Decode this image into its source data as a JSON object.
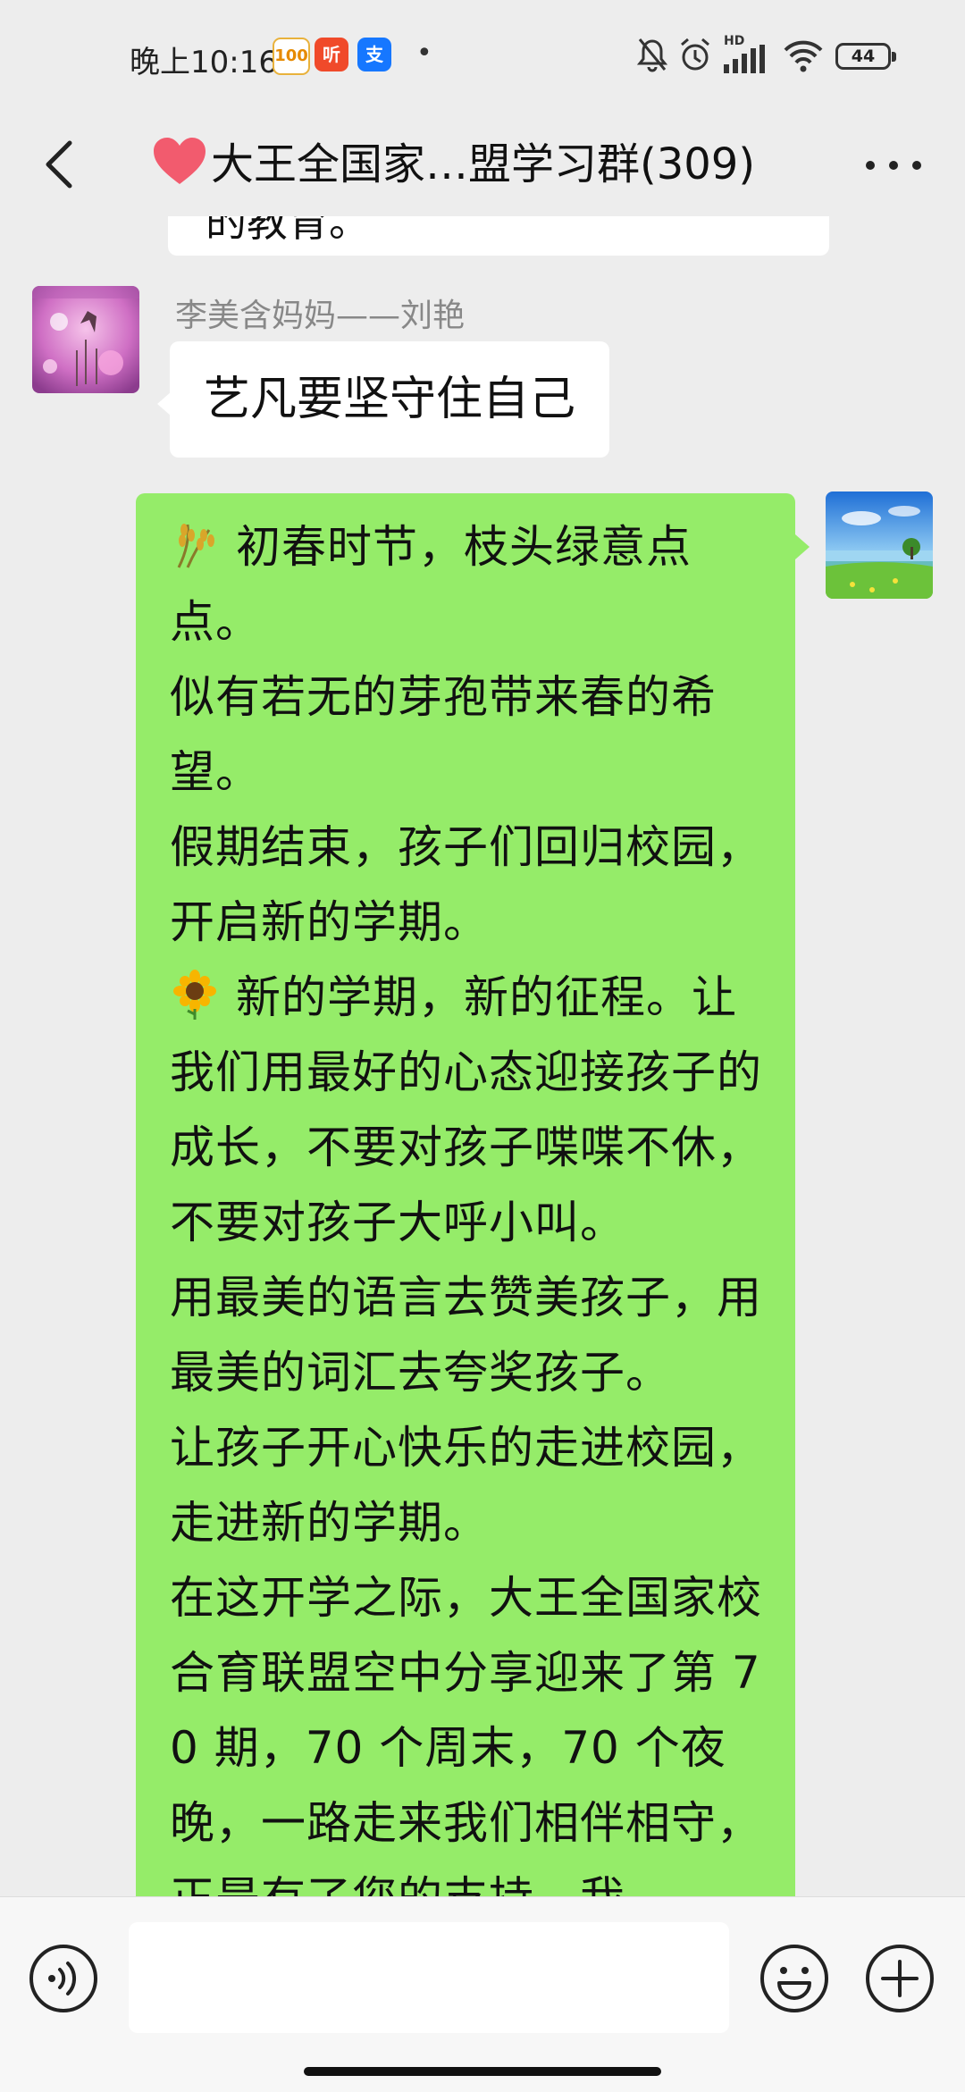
{
  "status_bar": {
    "time": "晚上10:16",
    "apps": [
      "100",
      "听",
      "支"
    ],
    "network_label": "HD",
    "battery": "44"
  },
  "header": {
    "title": "大王全国家…盟学习群(309)"
  },
  "messages": {
    "prev_text": "的教育。",
    "sender_name": "李美含妈妈——刘艳",
    "msg1_text": "艺凡要坚守住自己",
    "msg2_paragraphs": [
      "初春时节，枝头绿意点点。",
      "似有若无的芽孢带来春的希望。",
      "假期结束，孩子们回归校园，开启新的学期。",
      "新的学期，新的征程。让我们用最好的心态迎接孩子的成长，不要对孩子喋喋不休，不要对孩子大呼小叫。",
      "用最美的语言去赞美孩子，用最美的词汇去夸奖孩子。",
      "让孩子开心快乐的走进校园，走进新的学期。",
      "在这开学之际，大王全国家校合育联盟空中分享迎来了第 70 期，70 个周末，70 个夜晚，一路走来我们相伴相守，正是有了您的支持，我"
    ]
  },
  "input": {
    "value": ""
  },
  "colors": {
    "background": "#ededed",
    "my_bubble": "#95ec69",
    "other_bubble": "#ffffff",
    "sender_name": "#888888"
  },
  "icons": [
    "back-arrow-icon",
    "more-icon",
    "rice-emoji-icon",
    "sunflower-emoji-icon",
    "voice-icon",
    "emoji-icon",
    "plus-icon"
  ]
}
